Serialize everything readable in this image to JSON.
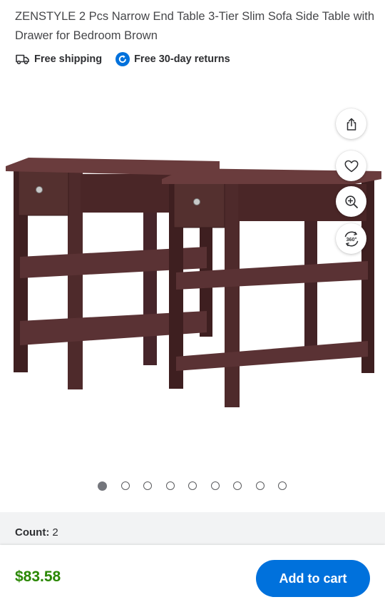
{
  "product": {
    "title": "ZENSTYLE 2 Pcs Narrow End Table 3-Tier Slim Sofa Side Table with Drawer for Bedroom Brown"
  },
  "badges": {
    "shipping": {
      "label": "Free shipping",
      "icon": "truck-icon"
    },
    "returns": {
      "label": "Free 30-day returns",
      "icon": "return-arrow-icon",
      "icon_color": "#0071dc"
    }
  },
  "image_actions": [
    {
      "name": "share",
      "icon": "share-icon"
    },
    {
      "name": "favorite",
      "icon": "heart-icon"
    },
    {
      "name": "zoom",
      "icon": "zoom-in-icon"
    },
    {
      "name": "view-360",
      "icon": "360-view-icon",
      "label": "360°"
    }
  ],
  "carousel": {
    "total": 9,
    "active_index": 0
  },
  "options": {
    "count_label": "Count:",
    "count_value": "2"
  },
  "purchase": {
    "price": "$83.58",
    "add_to_cart_label": "Add to cart"
  },
  "colors": {
    "price_green": "#2a8703",
    "brand_blue": "#0071dc",
    "wood_brown": "#4e2a2b"
  }
}
